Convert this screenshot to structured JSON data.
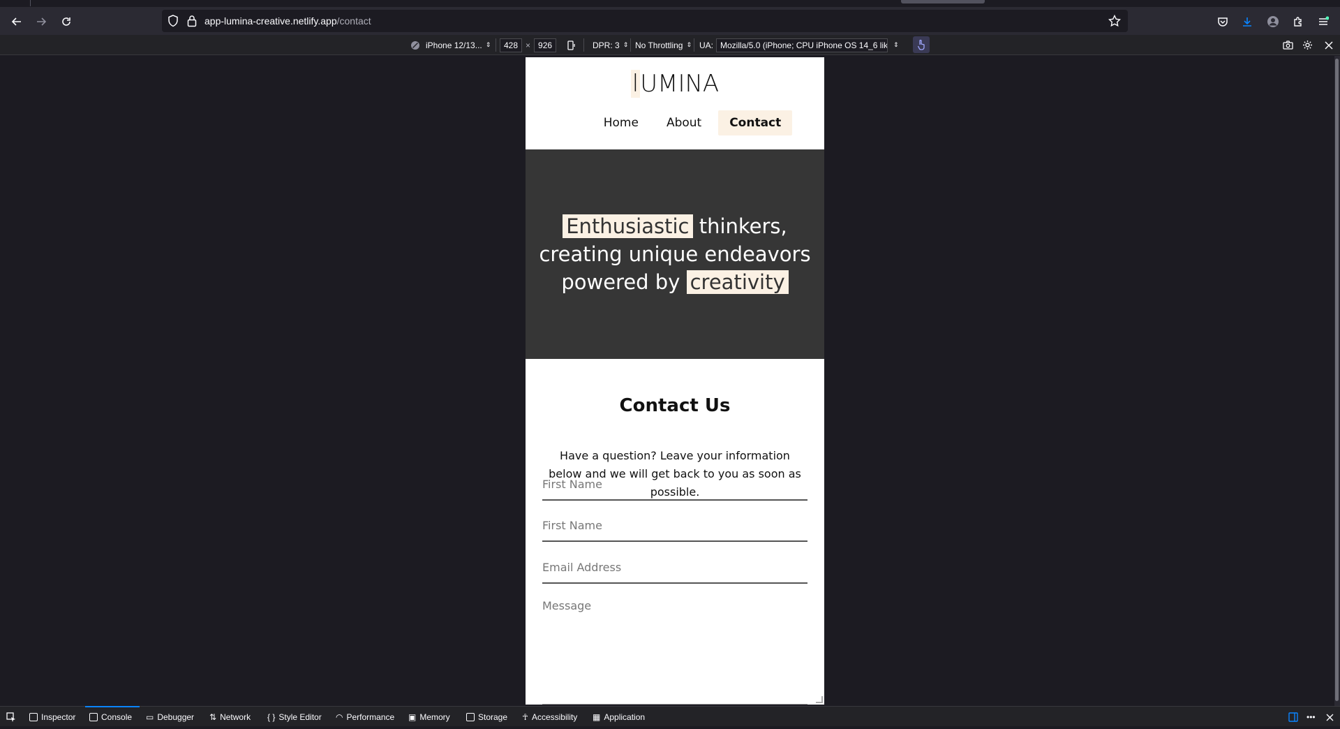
{
  "browser": {
    "url_host": "app-lumina-creative.netlify.app",
    "url_path": "/contact"
  },
  "rdm": {
    "device": "iPhone 12/13...",
    "width": "428",
    "times": "×",
    "height": "926",
    "dpr": "DPR: 3",
    "throttling": "No Throttling",
    "ua_label": "UA:",
    "ua_value": "Mozilla/5.0 (iPhone; CPU iPhone OS 14_6 like I"
  },
  "site": {
    "logo_first": "l",
    "logo_rest": "UMINA",
    "nav": {
      "home": "Home",
      "about": "About",
      "contact": "Contact"
    },
    "hero": {
      "w1": "Enthusiastic",
      "t1": " thinkers,",
      "line2": "creating unique endeavors",
      "t3": "powered by ",
      "w2": "creativity"
    },
    "contact": {
      "title": "Contact Us",
      "intro": "Have a question? Leave your information below and we will get back to you as soon as possible.",
      "field1_placeholder": "First Name",
      "field2_placeholder": "First Name",
      "email_placeholder": "Email Address",
      "message_placeholder": "Message"
    }
  },
  "devtools": {
    "tabs": {
      "inspector": "Inspector",
      "console": "Console",
      "debugger": "Debugger",
      "network": "Network",
      "style_editor": "Style Editor",
      "performance": "Performance",
      "memory": "Memory",
      "storage": "Storage",
      "accessibility": "Accessibility",
      "application": "Application"
    },
    "active_tab": "Console"
  },
  "colors": {
    "accent": "#0a84ff",
    "highlight": "#fbf1e4",
    "hero_bg": "#363636"
  }
}
